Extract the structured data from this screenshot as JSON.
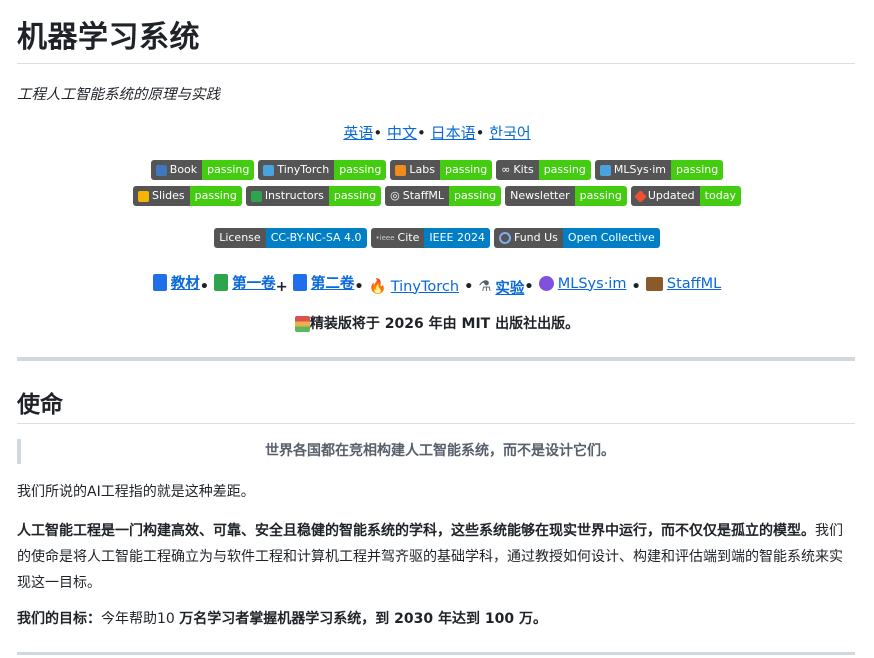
{
  "title": "机器学习系统",
  "subtitle": "工程人工智能系统的原理与实践",
  "languages": [
    {
      "label": "英语",
      "sep": "•"
    },
    {
      "label": "中文",
      "sep": "•"
    },
    {
      "label": "日本语",
      "sep": "•"
    },
    {
      "label": "한국어",
      "sep": ""
    }
  ],
  "badges_row1": [
    {
      "label": "Book",
      "value": "passing",
      "icon": "book-icon",
      "icon_color": "#4078c0"
    },
    {
      "label": "TinyTorch",
      "value": "passing",
      "icon": "torch-icon",
      "icon_color": "#4aa3df"
    },
    {
      "label": "Labs",
      "value": "passing",
      "icon": "bracket-icon",
      "icon_color": "#f28b1e"
    },
    {
      "label": "Kits",
      "value": "passing",
      "icon": "infinity-icon",
      "icon_color": "#ffffff"
    },
    {
      "label": "MLSys·im",
      "value": "passing",
      "icon": "python-icon",
      "icon_color": "#4aa3df"
    }
  ],
  "badges_row2": [
    {
      "label": "Slides",
      "value": "passing",
      "icon": "slides-icon",
      "icon_color": "#f4b400"
    },
    {
      "label": "Instructors",
      "value": "passing",
      "icon": "screen-icon",
      "icon_color": "#2ea44f"
    },
    {
      "label": "StaffML",
      "value": "passing",
      "icon": "target-icon",
      "icon_color": "#ffffff"
    },
    {
      "label": "Newsletter",
      "value": "passing",
      "icon": "",
      "icon_color": ""
    },
    {
      "label": "Updated",
      "value": "today",
      "icon": "git-icon",
      "icon_color": "#f05032"
    }
  ],
  "badges_row3": [
    {
      "label": "License",
      "value": "CC-BY-NC-SA 4.0",
      "icon": "",
      "icon_color": ""
    },
    {
      "label": "Cite",
      "value": "IEEE 2024",
      "icon": "ieee-icon",
      "icon_color": "#cccccc"
    },
    {
      "label": "Fund Us",
      "value": "Open Collective",
      "icon": "opencollective-icon",
      "icon_color": "#7fadf2"
    }
  ],
  "nav": [
    {
      "label": "教材",
      "sep": "•",
      "icon": "blue-book-icon",
      "icon_color": "#1f6feb"
    },
    {
      "label": "第一卷",
      "sep": "+",
      "icon": "green-book-icon",
      "icon_color": "#2da44e"
    },
    {
      "label": "第二卷",
      "sep": "•",
      "icon": "blue-book-icon",
      "icon_color": "#1f6feb"
    },
    {
      "label": "TinyTorch",
      "sep": "•",
      "icon": "flame-icon",
      "icon_color": "#f28b1e"
    },
    {
      "label": "实验",
      "sep": "•",
      "icon": "microscope-icon",
      "icon_color": "#57606a"
    },
    {
      "label": "MLSys·im",
      "sep": "•",
      "icon": "crystal-ball-icon",
      "icon_color": "#8250df"
    },
    {
      "label": "StaffML",
      "sep": "",
      "icon": "briefcase-icon",
      "icon_color": "#8a5a2b"
    }
  ],
  "notice": "精装版将于 2026 年由 MIT 出版社出版。",
  "mission_heading": "使命",
  "quote": "世界各国都在竞相构建人工智能系统，而不是设计它们。",
  "para1": "我们所说的AI工程指的就是这种差距。",
  "para2_bold": "人工智能工程是一门构建高效、可靠、安全且稳健的智能系统的学科，这些系统能够在现实世界中运行，而不仅仅是孤立的模型。",
  "para2_rest": "我们的使命是将人工智能工程确立为与软件工程和计算机工程并驾齐驱的基础学科，通过教授如何设计、构建和评估端到端的智能系统来实现这一目标。",
  "goal_label": "我们的目标：",
  "goal_text1": "今年帮助10 ",
  "goal_bold1": "万名学习者掌握机器学习系统",
  "goal_text2": "，到 2030 年达到 ",
  "goal_bold2": "100 万",
  "goal_text3": "。"
}
